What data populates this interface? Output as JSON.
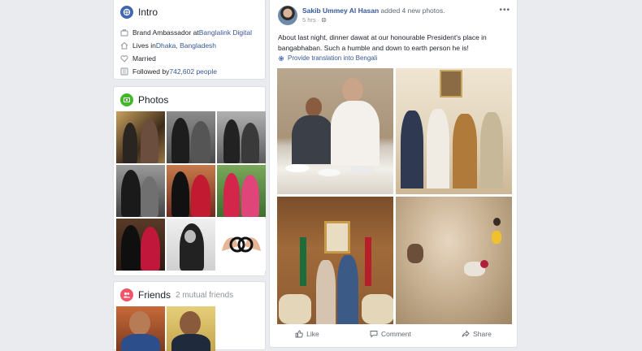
{
  "intro": {
    "title": "Intro",
    "rows": [
      {
        "icon": "briefcase-icon",
        "prefix": "Brand Ambassador at ",
        "link": "Banglalink Digital"
      },
      {
        "icon": "home-icon",
        "prefix": "Lives in ",
        "link": "Dhaka, Bangladesh"
      },
      {
        "icon": "heart-icon",
        "prefix": "Married",
        "link": ""
      },
      {
        "icon": "rss-icon",
        "prefix": "Followed by ",
        "link": "742,602 people"
      }
    ]
  },
  "photos": {
    "title": "Photos"
  },
  "friends": {
    "title": "Friends",
    "mutual": "2 mutual friends"
  },
  "post": {
    "author": "Sakib Ummey Al Hasan",
    "action": "added 4 new photos.",
    "time": "5 hrs",
    "text": "About last night, dinner dawat at our honourable President's place in bangabhaban. Such a humble and down to earth person he is!",
    "translate": "Provide translation into Bengali",
    "more": "•••",
    "actions": {
      "like": "Like",
      "comment": "Comment",
      "share": "Share"
    }
  },
  "colors": {
    "link": "#365899",
    "background": "#e9ebee",
    "intro_icon": "#4267b2",
    "photos_icon": "#42b72a",
    "friends_icon": "#f35369"
  }
}
